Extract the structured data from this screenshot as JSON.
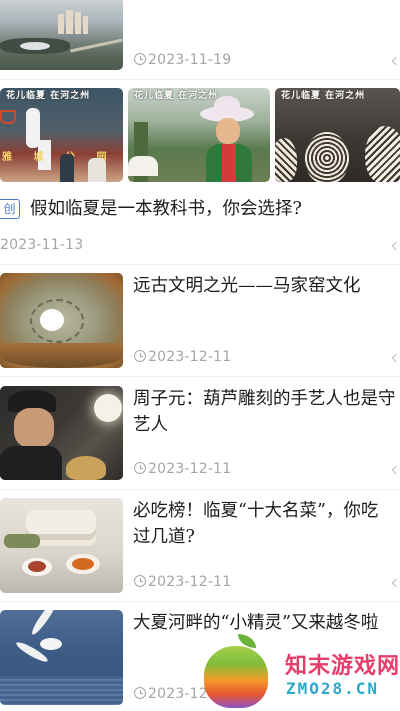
{
  "feed": {
    "top_item": {
      "date": "2023-11-19"
    },
    "gallery_item": {
      "photo_captions": [
        "花儿临夏 在河之州",
        "花儿临夏 在河之州",
        "花儿临夏 在河之州"
      ],
      "photo1_sign": "雅 城 公 园",
      "tag": "创",
      "title": "假如临夏是一本教科书，你会选择?",
      "date": "2023-11-13"
    },
    "articles": [
      {
        "title_line1": "远古文明之光——马家窑文化",
        "title_line2": "",
        "date": "2023-12-11",
        "thumb_icon": "pottery-thumbnail"
      },
      {
        "title_line1": "周子元：葫芦雕刻的手艺人也是守",
        "title_line2": "艺人",
        "date": "2023-12-11",
        "thumb_icon": "craftsman-thumbnail"
      },
      {
        "title_line1": "必吃榜！临夏“十大名菜”，你吃",
        "title_line2": "过几道?",
        "date": "2023-12-11",
        "thumb_icon": "food-thumbnail"
      },
      {
        "title_line1": "大夏河畔的“小精灵”又来越冬啦",
        "title_line2": "",
        "date": "2023-12",
        "thumb_icon": "seagull-thumbnail"
      }
    ]
  },
  "watermark": {
    "name": "知末游戏网",
    "domain": "ZMO28.CN"
  },
  "colors": {
    "accent": "#4d79c7",
    "date_gray": "#a5a5a5",
    "divider": "#eeeeee"
  }
}
